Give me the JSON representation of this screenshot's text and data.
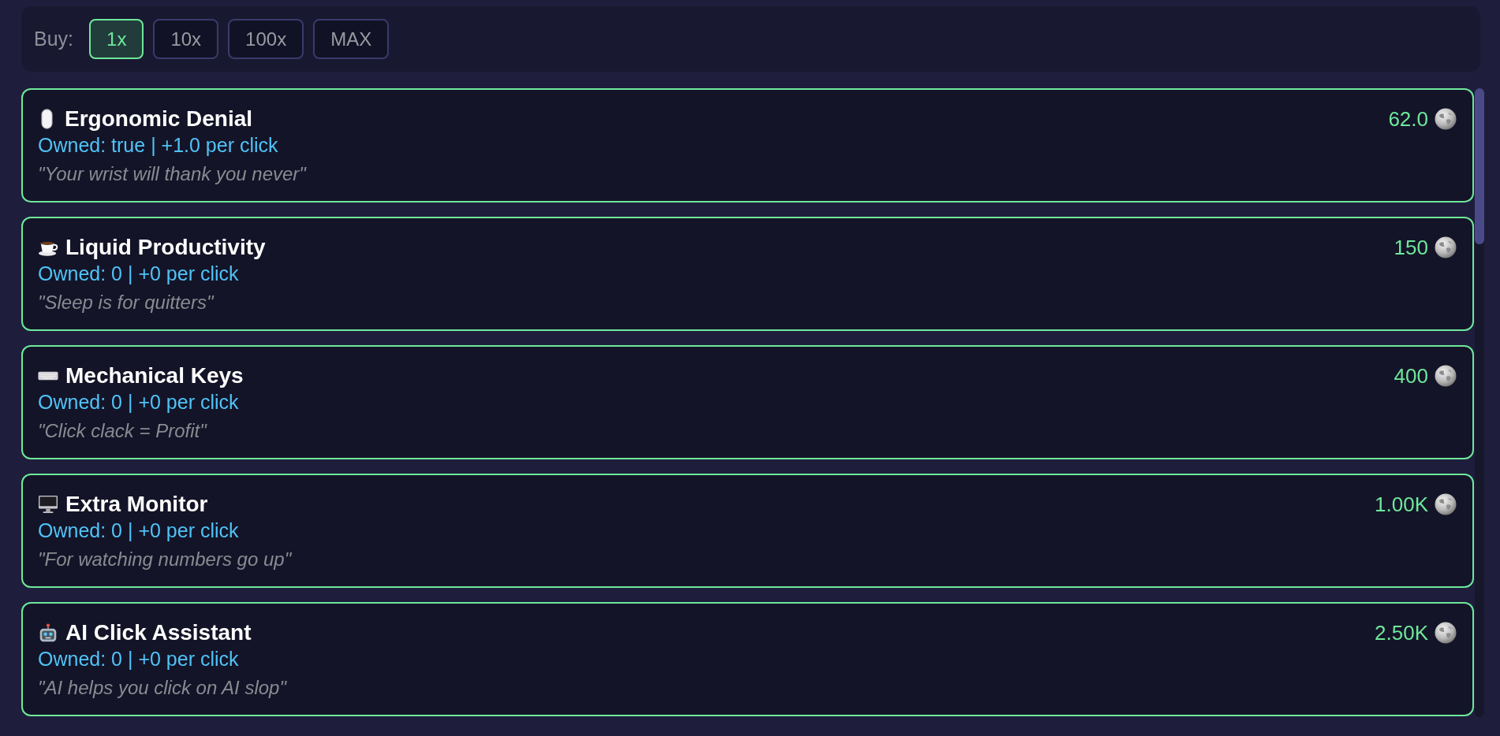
{
  "buy_bar": {
    "label": "Buy:",
    "options": [
      {
        "label": "1x",
        "selected": true
      },
      {
        "label": "10x",
        "selected": false
      },
      {
        "label": "100x",
        "selected": false
      },
      {
        "label": "MAX",
        "selected": false
      }
    ]
  },
  "upgrades": [
    {
      "name": "Ergonomic Denial",
      "stats": "Owned: true | +1.0 per click",
      "quote": "\"Your wrist will thank you never\"",
      "price": "62.0"
    },
    {
      "name": "Liquid Productivity",
      "stats": "Owned: 0 | +0 per click",
      "quote": "\"Sleep is for quitters\"",
      "price": "150"
    },
    {
      "name": "Mechanical Keys",
      "stats": "Owned: 0 | +0 per click",
      "quote": "\"Click clack = Profit\"",
      "price": "400"
    },
    {
      "name": "Extra Monitor",
      "stats": "Owned: 0 | +0 per click",
      "quote": "\"For watching numbers go up\"",
      "price": "1.00K"
    },
    {
      "name": "AI Click Assistant",
      "stats": "Owned: 0 | +0 per click",
      "quote": "\"AI helps you click on AI slop\"",
      "price": "2.50K"
    }
  ]
}
